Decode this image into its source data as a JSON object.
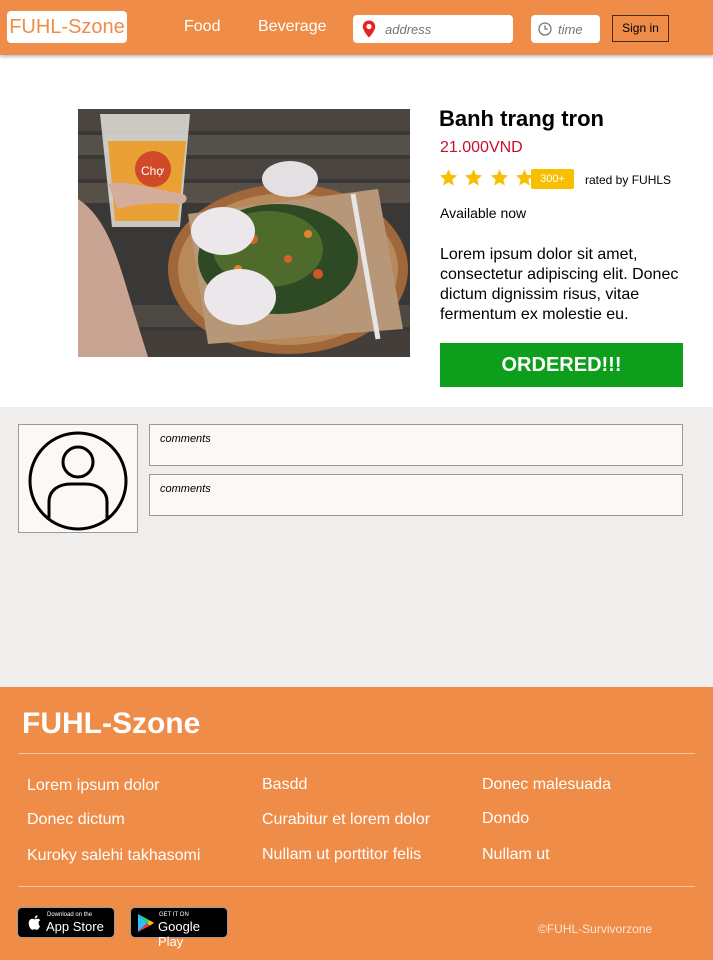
{
  "header": {
    "logo": "FUHL-Szone",
    "nav": [
      "Food",
      "Beverage"
    ],
    "address_placeholder": "address",
    "time_placeholder": "time",
    "signin_label": "Sign in"
  },
  "product": {
    "title": "Banh trang tron",
    "price": "21.000VND",
    "rating_stars": 4,
    "rating_count": "300+",
    "rated_by": "rated by FUHLS",
    "availability": "Available now",
    "description": "Lorem ipsum dolor sit amet, consectetur adipiscing elit. Donec dictum dignissim risus, vitae fermentum ex molestie eu.",
    "order_button": "ORDERED!!!"
  },
  "comments": [
    "comments",
    "comments"
  ],
  "footer": {
    "brand": "FUHL-Szone",
    "links": {
      "col1": [
        "Lorem ipsum dolor",
        "Donec dictum",
        "Kuroky salehi takhasomi"
      ],
      "col2": [
        "Basdd",
        "Curabitur et lorem dolor",
        "Nullam ut porttitor felis"
      ],
      "col3": [
        "Donec malesuada",
        "Dondo",
        "Nullam ut"
      ]
    },
    "app_store": {
      "small": "Download on the",
      "big": "App Store"
    },
    "google_play": {
      "small": "GET IT ON",
      "big": "Google Play"
    },
    "copyright": "©FUHL-Survivorzone"
  },
  "colors": {
    "brand_orange": "#ef8c47",
    "price_red": "#c8102e",
    "star_yellow": "#f6c000",
    "order_green": "#0d9e1b",
    "comment_bg": "#efeeec"
  }
}
